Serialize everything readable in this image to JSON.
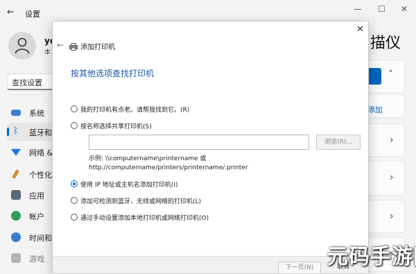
{
  "window": {
    "title": "设置",
    "minimize": "—",
    "maximize": "☐",
    "close": "✕",
    "back": "←"
  },
  "user": {
    "name": "ye",
    "sub": "本"
  },
  "search": {
    "placeholder": "查找设置"
  },
  "sidebar": {
    "items": [
      {
        "label": "系统",
        "icon": "monitor-icon",
        "color": "#3a7bd5"
      },
      {
        "label": "蓝牙和",
        "icon": "bluetooth-icon",
        "color": "#0067c0",
        "active": true
      },
      {
        "label": "网络 &",
        "icon": "wifi-icon",
        "color": "#1a73e8"
      },
      {
        "label": "个性化",
        "icon": "brush-icon",
        "color": "#d98b2b"
      },
      {
        "label": "应用",
        "icon": "apps-icon",
        "color": "#5a6b7d"
      },
      {
        "label": "帐户",
        "icon": "account-icon",
        "color": "#2e9e5b"
      },
      {
        "label": "时间和",
        "icon": "clock-icon",
        "color": "#3a7bd5"
      },
      {
        "label": "游戏",
        "icon": "game-icon",
        "color": "#8a8a8a"
      }
    ]
  },
  "main": {
    "heading": "描仪",
    "add_link": "添加",
    "chevron": "›",
    "expand": "˄"
  },
  "dialog": {
    "close": "✕",
    "back": "←",
    "title": "添加打印机",
    "heading": "按其他选项查找打印机",
    "options": [
      {
        "label": "我的打印机有点老。请帮我找到它。(R)",
        "selected": false
      },
      {
        "label": "按名称选择共享打印机(S)",
        "selected": false
      },
      {
        "label": "使用 IP 地址或主机名添加打印机(I)",
        "selected": true
      },
      {
        "label": "添加可检测到蓝牙、无线或网络的打印机(L)",
        "selected": false
      },
      {
        "label": "通过手动设置添加本地打印机或网络打印机(O)",
        "selected": false
      }
    ],
    "name_input_value": "",
    "browse_label": "浏览(R)...",
    "example_line1": "示例: \\\\computername\\printername 或",
    "example_line2": "http://computername/printers/printername/.printer",
    "next_label": "下一页(N)",
    "cancel_label": "取消"
  },
  "watermark": {
    "text": "元码手游网"
  },
  "colors": {
    "accent": "#0067c0",
    "heading_blue": "#1a56a8"
  }
}
